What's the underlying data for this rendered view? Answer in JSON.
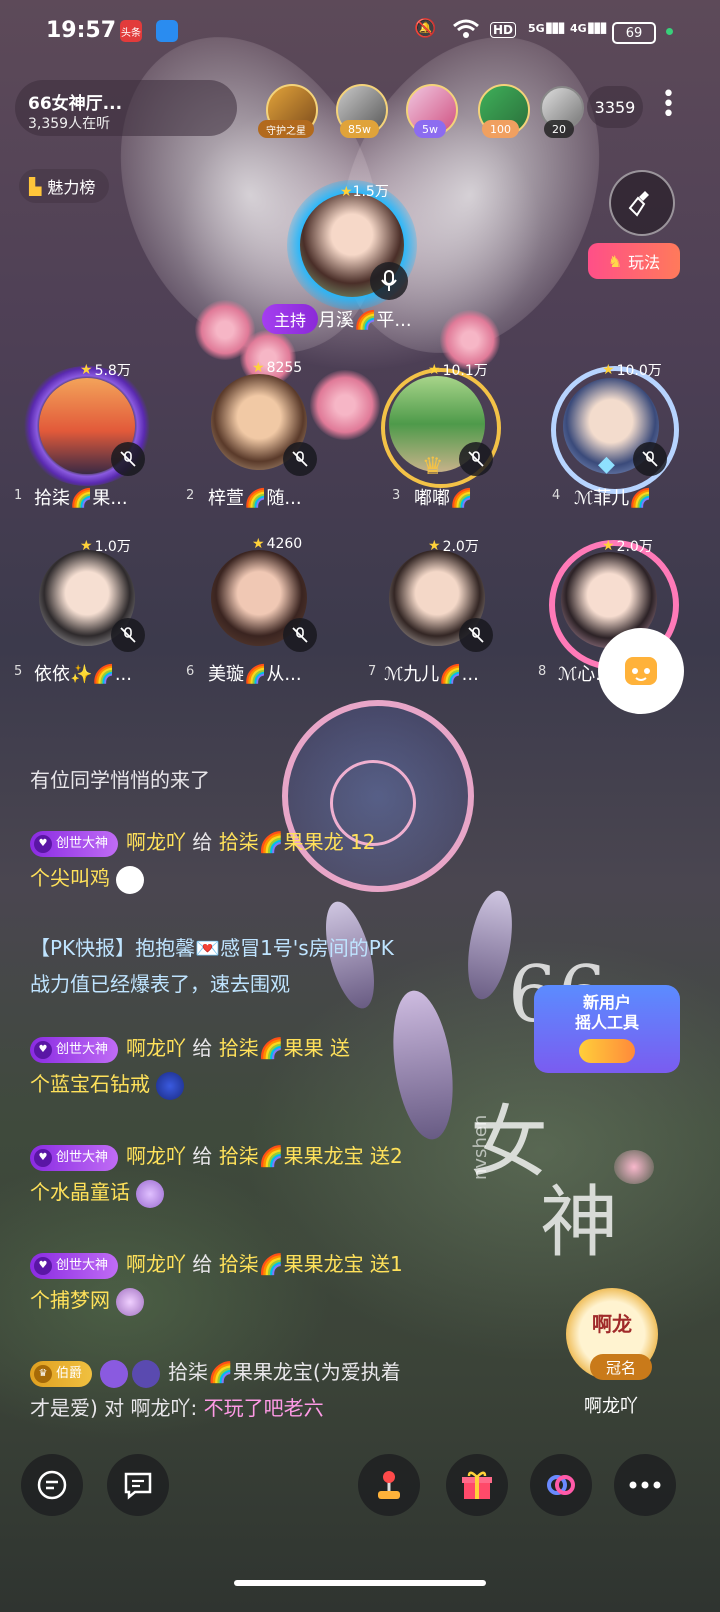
{
  "status_bar": {
    "time": "19:57",
    "app1": "头条",
    "battery": "69",
    "network_hd": "HD",
    "sig5g": "5G",
    "sig4g": "4G"
  },
  "room": {
    "title": "66女神厅...",
    "listeners": "3,359人在听",
    "count": "3359"
  },
  "top_ranks": [
    {
      "badge": "守护之星"
    },
    {
      "badge": "85w"
    },
    {
      "badge": "5w"
    },
    {
      "badge": "100"
    },
    {
      "badge": "20"
    }
  ],
  "charm_label": "魅力榜",
  "play_label": "玩法",
  "host": {
    "value": "1.5万",
    "tag": "主持",
    "name": "月溪🌈平..."
  },
  "seats": [
    {
      "num": "1",
      "value": "5.8万",
      "name": "拾柒🌈果..."
    },
    {
      "num": "2",
      "value": "8255",
      "name": "梓萱🌈随..."
    },
    {
      "num": "3",
      "value": "10.1万",
      "name": "嘟嘟🌈"
    },
    {
      "num": "4",
      "value": "10.0万",
      "name": "ℳ菲儿🌈"
    },
    {
      "num": "5",
      "value": "1.0万",
      "name": "依依✨🌈..."
    },
    {
      "num": "6",
      "value": "4260",
      "name": "美璇🌈从..."
    },
    {
      "num": "7",
      "value": "2.0万",
      "name": "ℳ九儿🌈..."
    },
    {
      "num": "8",
      "value": "2.0万",
      "name": "ℳ心..."
    }
  ],
  "chat": {
    "system": "有位同学悄悄的来了",
    "badge": "创世大神",
    "msg1": {
      "user": "啊龙吖",
      "gives": "给",
      "target": "拾柒🌈果果龙",
      "send": "12",
      "item": "个尖叫鸡"
    },
    "pk": {
      "line1": "【PK快报】抱抱馨💌感冒1号's房间的PK",
      "line2": "战力值已经爆表了，速去围观"
    },
    "msg2": {
      "user": "啊龙吖",
      "gives": "给",
      "target": "拾柒🌈果果",
      "send": "送",
      "item": "个蓝宝石钻戒"
    },
    "msg3": {
      "user": "啊龙吖",
      "gives": "给",
      "target": "拾柒🌈果果龙宝",
      "send": "送2",
      "item": "个水晶童话"
    },
    "msg4": {
      "user": "啊龙吖",
      "gives": "给",
      "target": "拾柒🌈果果龙宝",
      "send": "送1",
      "item": "个捕梦网"
    },
    "msg5": {
      "badge": "伯爵",
      "user": "拾柒🌈果果龙宝(为爱执着",
      "line2a": "才是爱) 对",
      "to": "啊龙吖:",
      "text": "不玩了吧老六"
    }
  },
  "new_user": {
    "line1": "新用户",
    "line2": "摇人工具"
  },
  "crown": {
    "tag": "冠名",
    "name": "啊龙吖",
    "logo": "啊龙"
  },
  "watermark": {
    "a": "66",
    "b": "女",
    "c": "神",
    "d": "nvshen"
  }
}
